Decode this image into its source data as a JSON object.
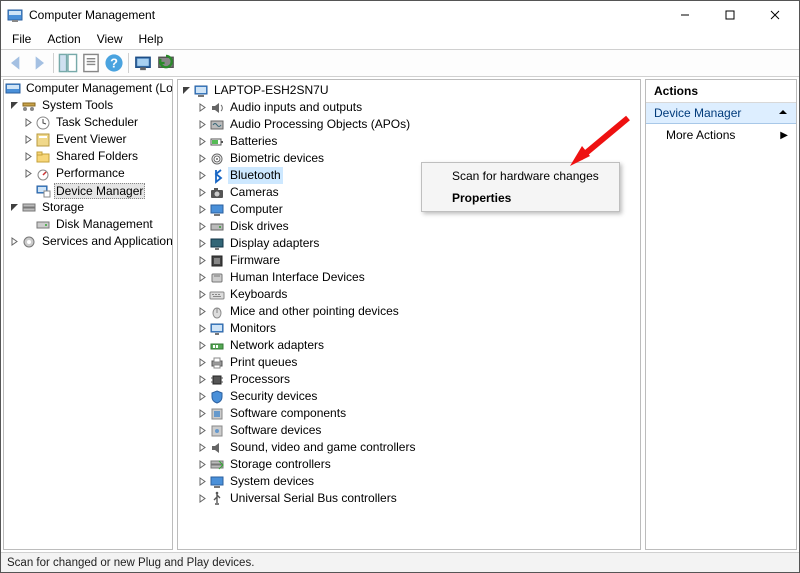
{
  "window": {
    "title": "Computer Management"
  },
  "menu": {
    "file": "File",
    "action": "Action",
    "view": "View",
    "help": "Help"
  },
  "left_tree": {
    "root": "Computer Management (Local)",
    "system_tools": {
      "label": "System Tools",
      "children": {
        "task_scheduler": "Task Scheduler",
        "event_viewer": "Event Viewer",
        "shared_folders": "Shared Folders",
        "performance": "Performance",
        "device_manager": "Device Manager"
      }
    },
    "storage": {
      "label": "Storage",
      "children": {
        "disk_management": "Disk Management"
      }
    },
    "services_apps": {
      "label": "Services and Applications"
    }
  },
  "center": {
    "computer": "LAPTOP-ESH2SN7U",
    "categories": [
      "Audio inputs and outputs",
      "Audio Processing Objects (APOs)",
      "Batteries",
      "Biometric devices",
      "Bluetooth",
      "Cameras",
      "Computer",
      "Disk drives",
      "Display adapters",
      "Firmware",
      "Human Interface Devices",
      "Keyboards",
      "Mice and other pointing devices",
      "Monitors",
      "Network adapters",
      "Print queues",
      "Processors",
      "Security devices",
      "Software components",
      "Software devices",
      "Sound, video and game controllers",
      "Storage controllers",
      "System devices",
      "Universal Serial Bus controllers"
    ],
    "selected_index": 4
  },
  "context_menu": {
    "scan": "Scan for hardware changes",
    "properties": "Properties"
  },
  "actions": {
    "header": "Actions",
    "selected": "Device Manager",
    "more": "More Actions"
  },
  "status": "Scan for changed or new Plug and Play devices."
}
